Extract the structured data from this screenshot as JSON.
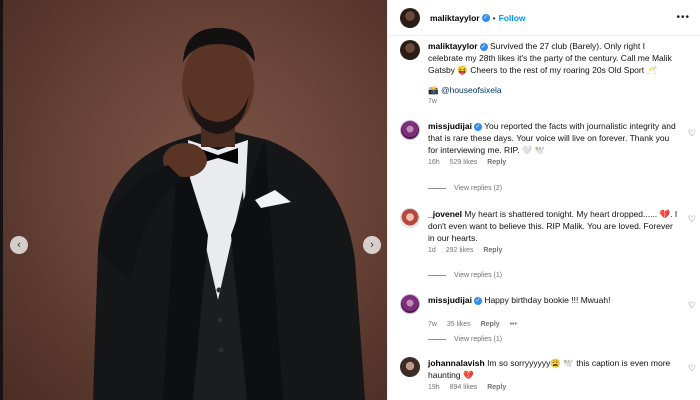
{
  "carousel": {
    "prev_icon": "‹",
    "next_icon": "›"
  },
  "header": {
    "username": "maliktayylor",
    "separator": "•",
    "follow_label": "Follow",
    "more_label": "•••"
  },
  "caption": {
    "username": "maliktayylor",
    "text": "Survived the 27 club (Barely). Only right I celebrate my 28th likes it's the party of the century. Call me Malik Gatsby 😝 Cheers to the rest of my roaring 20s Old Sport 🥂",
    "credit_icon": "📸",
    "credit": "@houseofsixela",
    "time": "7w"
  },
  "comments": [
    {
      "username": "missjudijai",
      "text": "You reported the facts with journalistic integrity and that is rare these days. Your voice will live on forever. Thank you for interviewing me. RIP. 🤍 🕊️",
      "time": "16h",
      "likes": "529 likes",
      "reply_label": "Reply",
      "view_replies": "View replies (2)"
    },
    {
      "username": "_jovenel",
      "text": "My heart is shattered tonight. My heart dropped...... 💔. I don't even want to believe this. RIP Malik. You are loved. Forever in our hearts.",
      "time": "1d",
      "likes": "292 likes",
      "reply_label": "Reply",
      "view_replies": "View replies (1)"
    },
    {
      "username": "missjudijai",
      "text": "Happy birthday bookie !!! Mwuah!",
      "time": "7w",
      "likes": "35 likes",
      "reply_label": "Reply",
      "more_label": "•••",
      "view_replies": "View replies (1)"
    },
    {
      "username": "johannalavish",
      "text": "Im so sorryyyyyy😩 🕊️ this caption is even more haunting 💔",
      "time": "19h",
      "likes": "894 likes",
      "reply_label": "Reply"
    }
  ],
  "icons": {
    "verified": "✓",
    "like": "♡"
  },
  "colors": {
    "follow": "#0095f6",
    "verified": "#2f8cf0",
    "backdrop": "#6a4438"
  }
}
